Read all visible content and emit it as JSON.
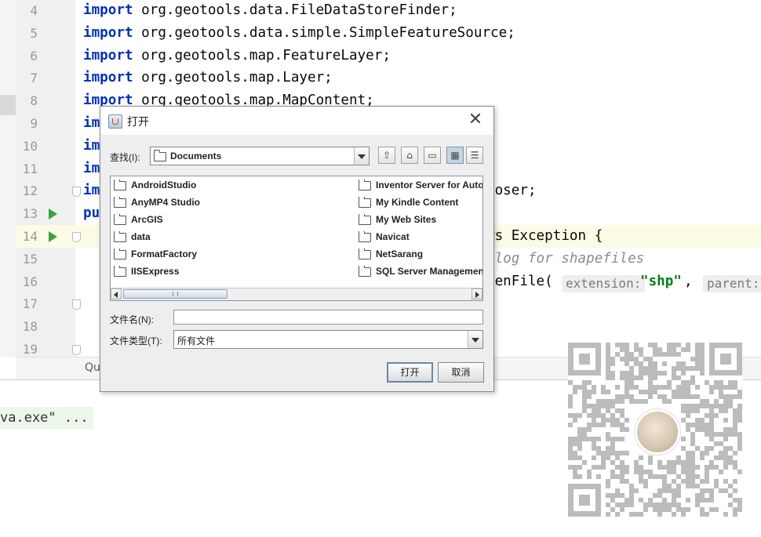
{
  "editor": {
    "lines": [
      {
        "n": "4",
        "code": "import org.geotools.data.FileDataStoreFinder;"
      },
      {
        "n": "5",
        "code": "import org.geotools.data.simple.SimpleFeatureSource;"
      },
      {
        "n": "6",
        "code": "import org.geotools.map.FeatureLayer;"
      },
      {
        "n": "7",
        "code": "import org.geotools.map.Layer;"
      },
      {
        "n": "8",
        "code": "import org.geotools.map.MapContent;"
      },
      {
        "n": "9",
        "code": "im"
      },
      {
        "n": "10",
        "code": "im"
      },
      {
        "n": "11",
        "code": "im"
      },
      {
        "n": "12",
        "code": "im",
        "right": "ooser;"
      },
      {
        "n": "13",
        "code": "pu"
      },
      {
        "n": "14",
        "code": "",
        "right": "ws Exception {"
      },
      {
        "n": "15",
        "code": "",
        "right": "alog for shapefiles"
      },
      {
        "n": "16",
        "code": "",
        "right": "penFile("
      },
      {
        "n": "17",
        "code": ""
      },
      {
        "n": "18",
        "code": ""
      },
      {
        "n": "19",
        "code": ""
      }
    ],
    "keyword": "import",
    "hint_extension": "extension:",
    "string_shp": "\"shp\"",
    "comma": ",",
    "hint_parent": "parent:",
    "breadcrumb": "Qu",
    "console_text": "va.exe\" ..."
  },
  "dialog": {
    "title": "打开",
    "close_glyph": "✕",
    "look_in_label": "查找(I):",
    "look_in_value": "Documents",
    "toolbar": [
      {
        "name": "up-one-level-icon",
        "glyph": "⇧"
      },
      {
        "name": "home-icon",
        "glyph": "⌂"
      },
      {
        "name": "new-folder-icon",
        "glyph": "▭"
      },
      {
        "name": "list-view-icon",
        "glyph": "▦"
      },
      {
        "name": "details-view-icon",
        "glyph": "☰"
      }
    ],
    "files_left": [
      "AndroidStudio",
      "AnyMP4 Studio",
      "ArcGIS",
      "data",
      "FormatFactory",
      "IISExpress"
    ],
    "files_right": [
      "Inventor Server for AutoC",
      "My Kindle Content",
      "My Web Sites",
      "Navicat",
      "NetSarang",
      "SQL Server Management"
    ],
    "file_name_label": "文件名(N):",
    "file_name_value": "",
    "file_type_label": "文件类型(T):",
    "file_type_value": "所有文件",
    "open_button": "打开",
    "cancel_button": "取消"
  }
}
